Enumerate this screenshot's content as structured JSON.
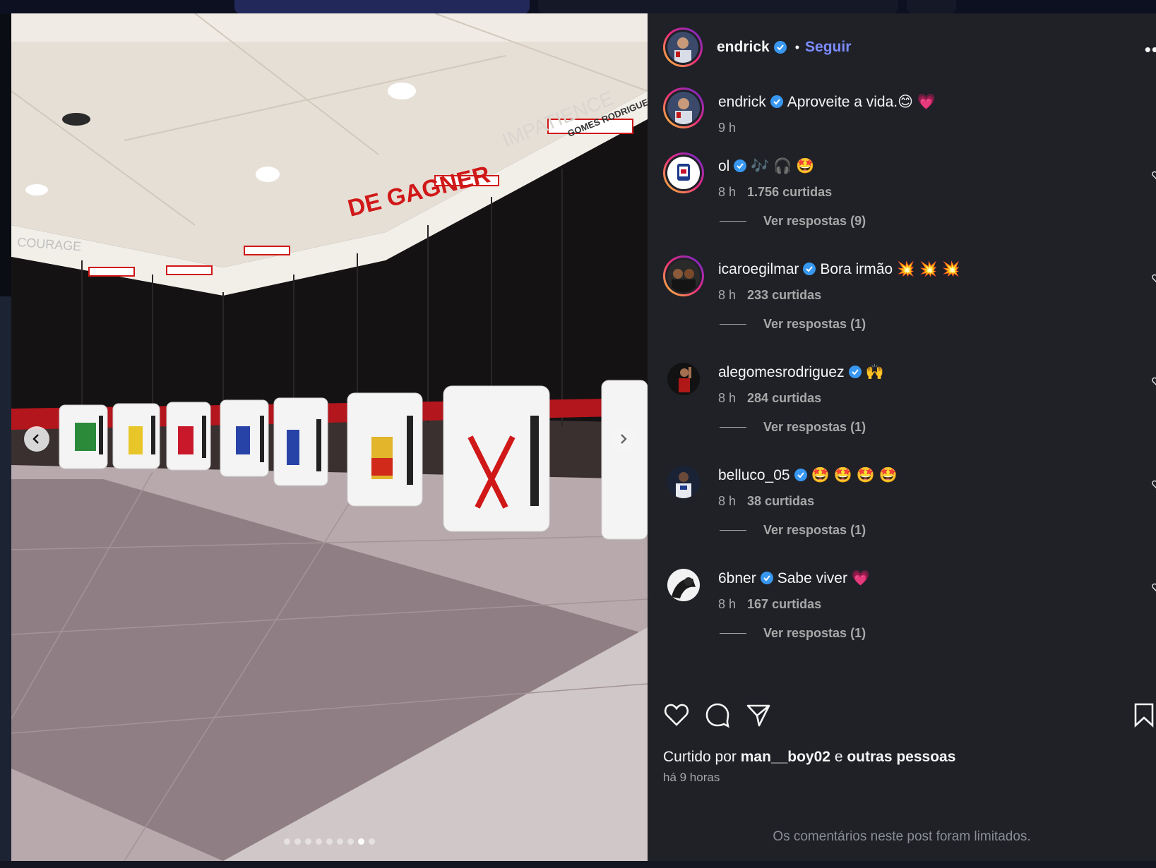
{
  "post": {
    "author": "endrick",
    "follow_label": "Seguir",
    "separator": "•",
    "caption": {
      "user": "endrick",
      "text": "Aproveite a vida.😊 💗",
      "time": "9 h"
    },
    "image": {
      "wall_texts": [
        "COURAGE",
        "DE GAGNER",
        "IMPATIENCE",
        "GOMES RODRIGUEZ"
      ],
      "slides_total": 9,
      "active_slide": 8
    }
  },
  "comments": [
    {
      "user": "ol",
      "text": "🎶 🎧 🤩",
      "time": "8 h",
      "likes": "1.756 curtidas",
      "replies": "Ver respostas (9)",
      "story": true
    },
    {
      "user": "icaroegilmar",
      "text": "Bora irmão 💥 💥 💥",
      "time": "8 h",
      "likes": "233 curtidas",
      "replies": "Ver respostas (1)",
      "story": true
    },
    {
      "user": "alegomesrodriguez",
      "text": "🙌",
      "time": "8 h",
      "likes": "284 curtidas",
      "replies": "Ver respostas (1)",
      "story": false
    },
    {
      "user": "belluco_05",
      "text": "🤩 🤩 🤩 🤩",
      "time": "8 h",
      "likes": "38 curtidas",
      "replies": "Ver respostas (1)",
      "story": false
    },
    {
      "user": "6bner",
      "text": "Sabe viver 💗",
      "time": "8 h",
      "likes": "167 curtidas",
      "replies": "Ver respostas (1)",
      "story": false
    }
  ],
  "likes_summary": {
    "prefix": "Curtido por",
    "user": "man__boy02",
    "conj": "e",
    "others": "outras pessoas"
  },
  "posted_ago": "há 9 horas",
  "comments_limited": "Os comentários neste post foram limitados.",
  "more_glyph": "•••",
  "colors": {
    "panel_bg": "#1f2127",
    "accent_link": "#7c8cff",
    "verified": "#3897f0",
    "muted_text": "#a8a8a8"
  },
  "icons": [
    "more-icon",
    "chevron-left-icon",
    "chevron-right-icon",
    "verified-icon",
    "heart-icon",
    "comment-icon",
    "share-icon",
    "bookmark-icon"
  ]
}
